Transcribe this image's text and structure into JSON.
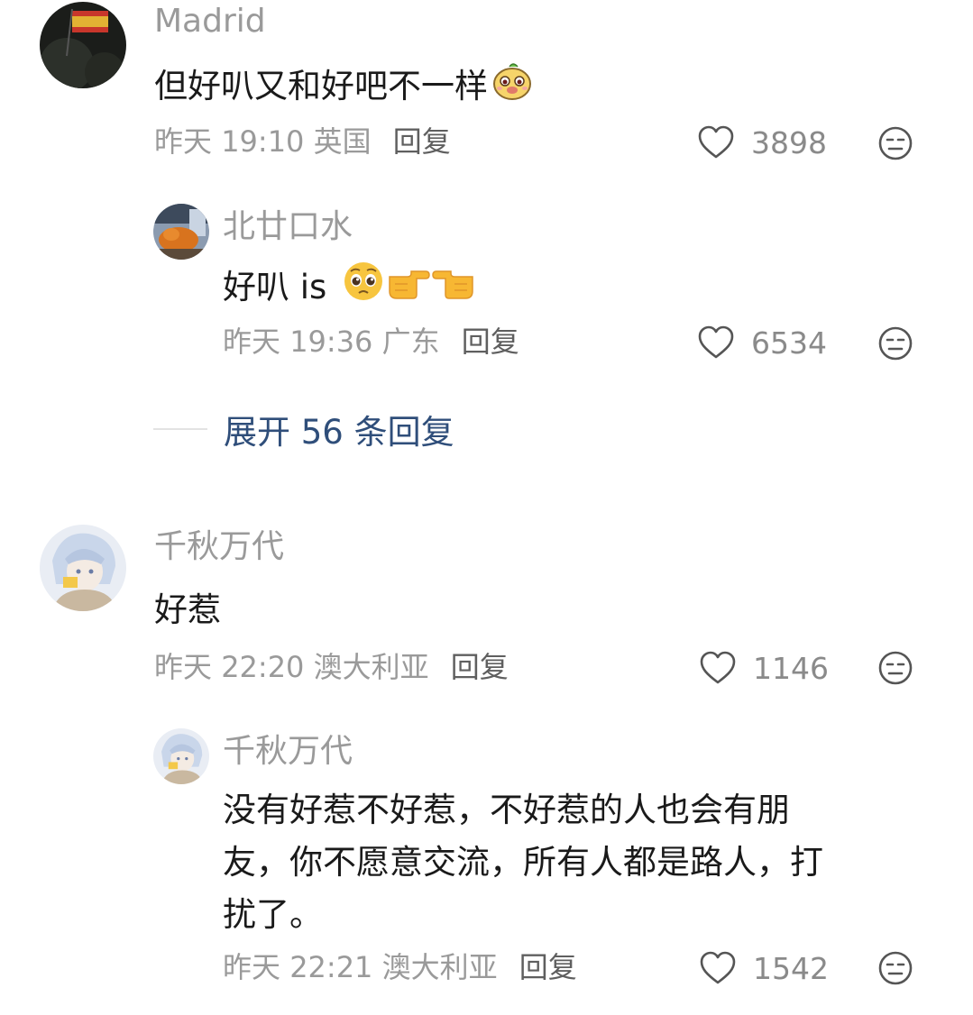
{
  "comments": [
    {
      "username": "Madrid",
      "text": "但好叭又和好吧不一样",
      "date": "昨天",
      "time": "19:10",
      "location": "英国",
      "reply_label": "回复",
      "likes": "3898",
      "icons": [
        "heart-outline-icon",
        "meh-face-icon",
        "sticker-icon"
      ]
    },
    {
      "username": "北廿口水",
      "text": "好叭 is",
      "date": "昨天",
      "time": "19:36",
      "location": "广东",
      "reply_label": "回复",
      "likes": "6534",
      "icons": [
        "pleading-face-icon",
        "point-right-icon",
        "point-left-icon"
      ]
    },
    {
      "username": "千秋万代",
      "text": "好惹",
      "date": "昨天",
      "time": "22:20",
      "location": "澳大利亚",
      "reply_label": "回复",
      "likes": "1146"
    },
    {
      "username": "千秋万代",
      "text_lines": [
        "没有好惹不好惹，不好惹的人也会有朋",
        "友，你不愿意交流，所有人都是路人，打",
        "扰了。"
      ],
      "date": "昨天",
      "time": "22:21",
      "location": "澳大利亚",
      "reply_label": "回复",
      "likes": "1542"
    }
  ],
  "expand_replies": "展开 56 条回复",
  "colors": {
    "username": "#9a9a9a",
    "content": "#1a1a1a",
    "meta": "#9a9a9a",
    "reply": "#5f5f5f",
    "expand_link": "#2f4e7a"
  }
}
